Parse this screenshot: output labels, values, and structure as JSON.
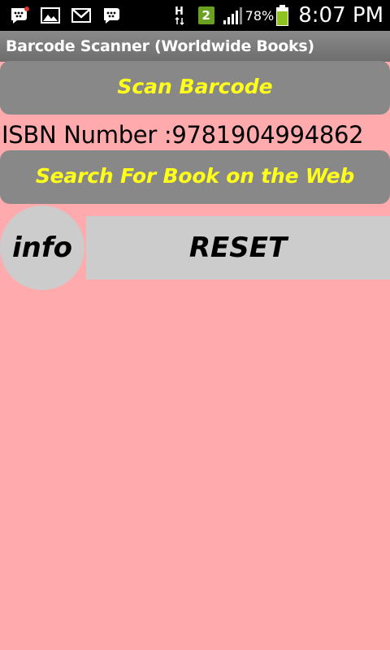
{
  "status_bar": {
    "icons_left": [
      "bbm-notification-icon",
      "gallery-icon",
      "gmail-icon",
      "bbm-icon"
    ],
    "network_label": "H",
    "sim_number": "2",
    "battery_percent": "78%",
    "time": "8:07 PM"
  },
  "app": {
    "title": "Barcode Scanner (Worldwide Books)"
  },
  "buttons": {
    "scan": "Scan Barcode",
    "search": "Search For Book on the Web",
    "info": "info",
    "reset": "RESET"
  },
  "isbn": {
    "text": "ISBN Number :9781904994862"
  },
  "colors": {
    "background": "#ffaaad",
    "button_gray": "#888888",
    "button_text": "#ffff1a",
    "light_button": "#cccccc"
  }
}
